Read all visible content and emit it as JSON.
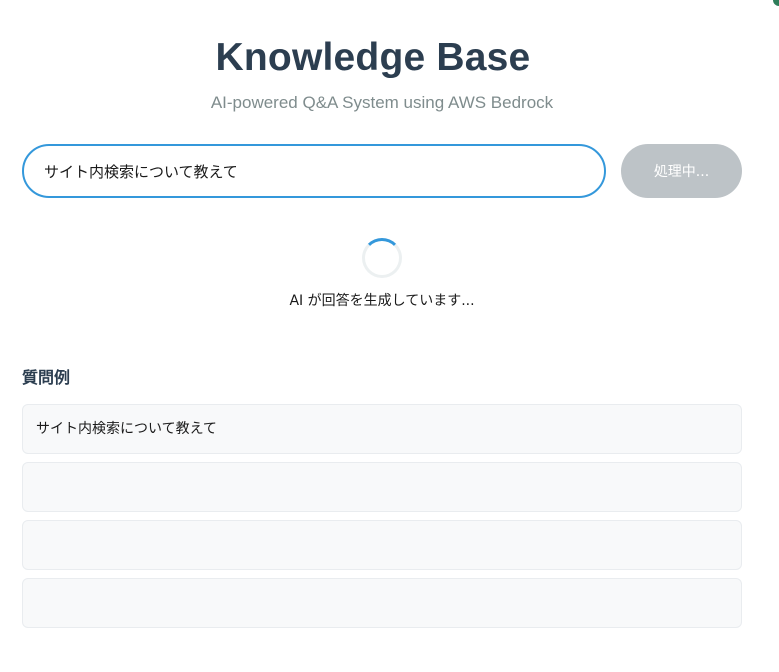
{
  "header": {
    "title": "Knowledge Base",
    "subtitle": "AI-powered Q&A System using AWS Bedrock"
  },
  "search": {
    "value": "サイト内検索について教えて",
    "submit_label": "処理中..."
  },
  "loading": {
    "text": "AI が回答を生成しています..."
  },
  "examples": {
    "heading": "質問例",
    "items": [
      {
        "label": "サイト内検索について教えて"
      },
      {
        "label": ""
      },
      {
        "label": ""
      },
      {
        "label": ""
      }
    ]
  },
  "colors": {
    "accent": "#3498db",
    "title": "#2c3e50",
    "subtitle": "#7f8c8d",
    "button_disabled": "#bdc3c7",
    "example_bg": "#f8f9fa"
  }
}
